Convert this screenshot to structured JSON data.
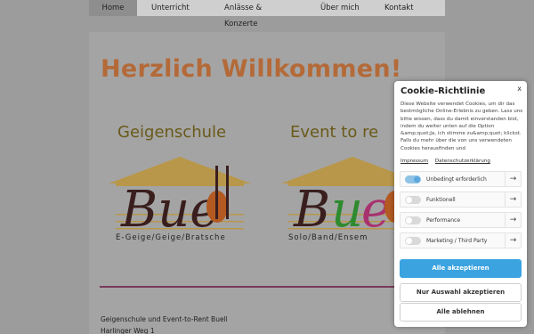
{
  "nav": {
    "items": [
      "Home",
      "Unterricht",
      "Anlässe & Konzerte",
      "Über mich",
      "Kontakt"
    ]
  },
  "main": {
    "welcome": "Herzlich Willkommen!",
    "logos": [
      {
        "top": "Geigenschule",
        "sub": "E-Geige/Geige/Bratsche"
      },
      {
        "top": "Event to re",
        "sub": "Solo/Band/Ensem"
      }
    ],
    "address": [
      "Geigenschule und Event-to-Rent Buell",
      "Harlinger Weg 1"
    ]
  },
  "cookie": {
    "title": "Cookie-Richtlinie",
    "close": "x",
    "text": "Diese Website verwendet Cookies, um dir das bestmögliche Online-Erlebnis zu geben. Lass uns bitte wissen, dass du damit einverstanden bist, indem du weiter unten auf die Option &amp;quot;Ja, ich stimme zu&amp;quot; klickst. Falls du mehr über die von uns verwendeten Cookies herausfinden und",
    "link_impressum": "Impressum",
    "link_privacy": "Datenschutzerklärung",
    "options": [
      {
        "label": "Unbedingt erforderlich",
        "enabled": true
      },
      {
        "label": "Funktionell",
        "enabled": false
      },
      {
        "label": "Performance",
        "enabled": false
      },
      {
        "label": "Marketing / Third Party",
        "enabled": false
      }
    ],
    "arrow": "→",
    "accept_all": "Alle akzeptieren",
    "accept_selection": "Nur Auswahl akzeptieren",
    "reject_all": "Alle ablehnen",
    "accent_color": "#3aa3e0"
  }
}
